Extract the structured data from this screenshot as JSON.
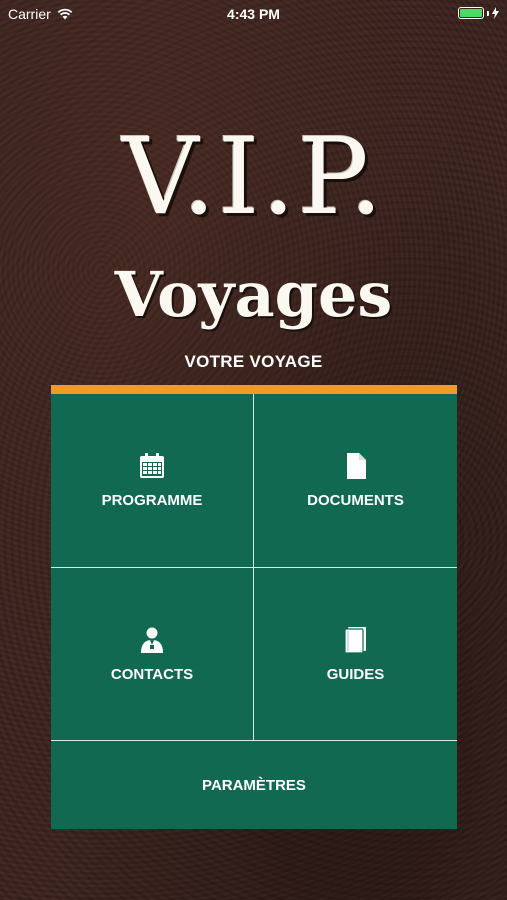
{
  "status_bar": {
    "carrier": "Carrier",
    "time": "4:43 PM",
    "battery_level": 1.0,
    "battery_color": "#4cd964"
  },
  "logo": {
    "line1": "V.I.P.",
    "line2": "Voyages"
  },
  "section_title": "VOTRE VOYAGE",
  "colors": {
    "tile_background": "#116951",
    "accent": "#f09a2b"
  },
  "menu": {
    "programme": {
      "label": "PROGRAMME",
      "icon": "calendar-icon"
    },
    "documents": {
      "label": "DOCUMENTS",
      "icon": "document-icon"
    },
    "contacts": {
      "label": "CONTACTS",
      "icon": "contact-person-icon"
    },
    "guides": {
      "label": "GUIDES",
      "icon": "book-icon"
    },
    "parametres": {
      "label": "PARAMÈTRES"
    }
  }
}
